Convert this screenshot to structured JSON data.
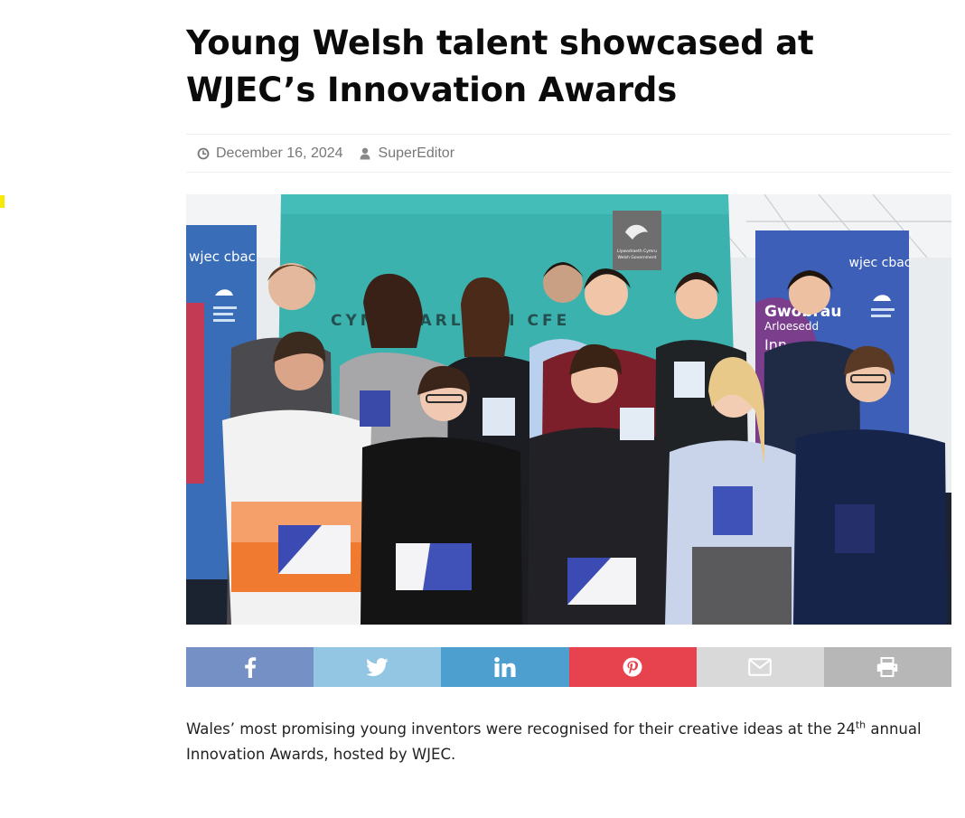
{
  "article": {
    "title": "Young Welsh talent showcased at WJEC’s Innovation Awards",
    "date": "December 16, 2024",
    "author": "SuperEditor",
    "date_icon": "clock-icon",
    "author_icon": "user-icon",
    "hero_image": {
      "banner_brand": "wjec cbac",
      "banner_right_text_1": "Gwobrau",
      "banner_right_text_2": "Arloesedd",
      "banner_right_text_3": "Inn",
      "backdrop_text": "CYMRU ARLOESI CFE",
      "sponsor_text_1": "Llywodraeth Cymru",
      "sponsor_text_2": "Welsh Government"
    },
    "intro_before": "Wales’ most promising young inventors were recognised for their creative ideas at the 24",
    "intro_sup": "th",
    "intro_after": " annual Innovation Awards, hosted by WJEC."
  },
  "share_bar": {
    "buttons": [
      {
        "name": "facebook",
        "icon": "facebook-icon",
        "color": "#7490c4"
      },
      {
        "name": "twitter",
        "icon": "twitter-icon",
        "color": "#93c6e3"
      },
      {
        "name": "linkedin",
        "icon": "linkedin-icon",
        "color": "#4d9fd0"
      },
      {
        "name": "pinterest",
        "icon": "pinterest-icon",
        "color": "#e7434e"
      },
      {
        "name": "email",
        "icon": "envelope-icon",
        "color": "#d9d9d9"
      },
      {
        "name": "print",
        "icon": "printer-icon",
        "color": "#b7b7b7"
      }
    ]
  },
  "colors": {
    "marker": "#f7ea00",
    "meta_text": "#777777",
    "title": "#0b0b0b"
  }
}
